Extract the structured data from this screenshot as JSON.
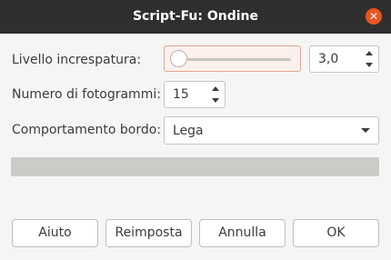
{
  "window": {
    "title": "Script-Fu: Ondine"
  },
  "icons": {
    "close": "close-icon",
    "spin_up": "spin-up-icon",
    "spin_down": "spin-down-icon",
    "combo": "chevron-down-icon"
  },
  "colors": {
    "titlebar": "#2f2f2f",
    "close": "#e95420",
    "accent": "#e95420",
    "background": "#f6f5f4"
  },
  "fields": {
    "ripple": {
      "label": "Livello increspatura:",
      "value": "3,0",
      "slider_fraction": 0.0
    },
    "frames": {
      "label": "Numero di fotogrammi:",
      "value": "15"
    },
    "edge": {
      "label": "Comportamento bordo:",
      "value": "Lega"
    }
  },
  "progress": {
    "fraction": 0.0
  },
  "buttons": {
    "help": "Aiuto",
    "reset": "Reimposta",
    "cancel": "Annulla",
    "ok": "OK"
  }
}
